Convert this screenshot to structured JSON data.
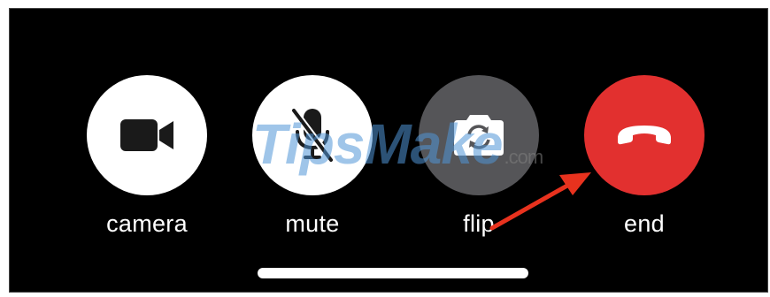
{
  "controls": [
    {
      "id": "camera",
      "label": "camera",
      "icon": "video-camera-icon",
      "bg": "#ffffff",
      "fg": "#1a1a1a"
    },
    {
      "id": "mute",
      "label": "mute",
      "icon": "microphone-slash-icon",
      "bg": "#ffffff",
      "fg": "#1a1a1a"
    },
    {
      "id": "flip",
      "label": "flip",
      "icon": "camera-rotate-icon",
      "bg": "#555558",
      "fg": "#ffffff"
    },
    {
      "id": "end",
      "label": "end",
      "icon": "phone-hangup-icon",
      "bg": "#e2302f",
      "fg": "#ffffff"
    }
  ],
  "watermark": {
    "text": "TipsMake",
    "suffix": ".com"
  },
  "annotation": {
    "arrow_color": "#e8321e",
    "target": "end"
  }
}
